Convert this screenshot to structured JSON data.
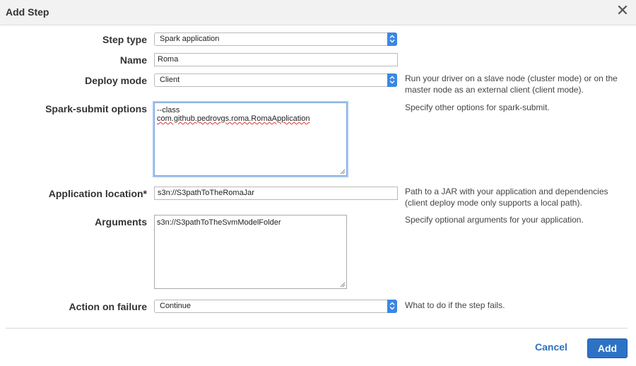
{
  "dialog": {
    "title": "Add Step",
    "close_glyph": "✕",
    "close_icon": "close-icon"
  },
  "form": {
    "step_type": {
      "label": "Step type",
      "value": "Spark application"
    },
    "name": {
      "label": "Name",
      "value": "Roma"
    },
    "deploy_mode": {
      "label": "Deploy mode",
      "value": "Client",
      "help_line1": "Run your driver on a slave node (cluster mode) or on the",
      "help_line2": "master node as an external client (client mode)."
    },
    "spark_submit": {
      "label": "Spark-submit options",
      "line1": "--class",
      "line2": "com.github.pedrovgs.roma.RomaApplication",
      "help": "Specify other options for spark-submit."
    },
    "app_location": {
      "label": "Application location*",
      "value": "s3n://S3pathToTheRomaJar",
      "help_line1": "Path to a JAR with your application and dependencies",
      "help_line2": "(client deploy mode only supports a local path)."
    },
    "arguments": {
      "label": "Arguments",
      "value": "s3n://S3pathToTheSvmModelFolder",
      "help": "Specify optional arguments for your application."
    },
    "action_on_failure": {
      "label": "Action on failure",
      "value": "Continue",
      "help": "What to do if the step fails."
    }
  },
  "footer": {
    "cancel_label": "Cancel",
    "add_label": "Add"
  },
  "colors": {
    "accent": "#2d72c4",
    "select_arrow": "#3b87e3",
    "focus_ring": "#a9c8f2"
  }
}
